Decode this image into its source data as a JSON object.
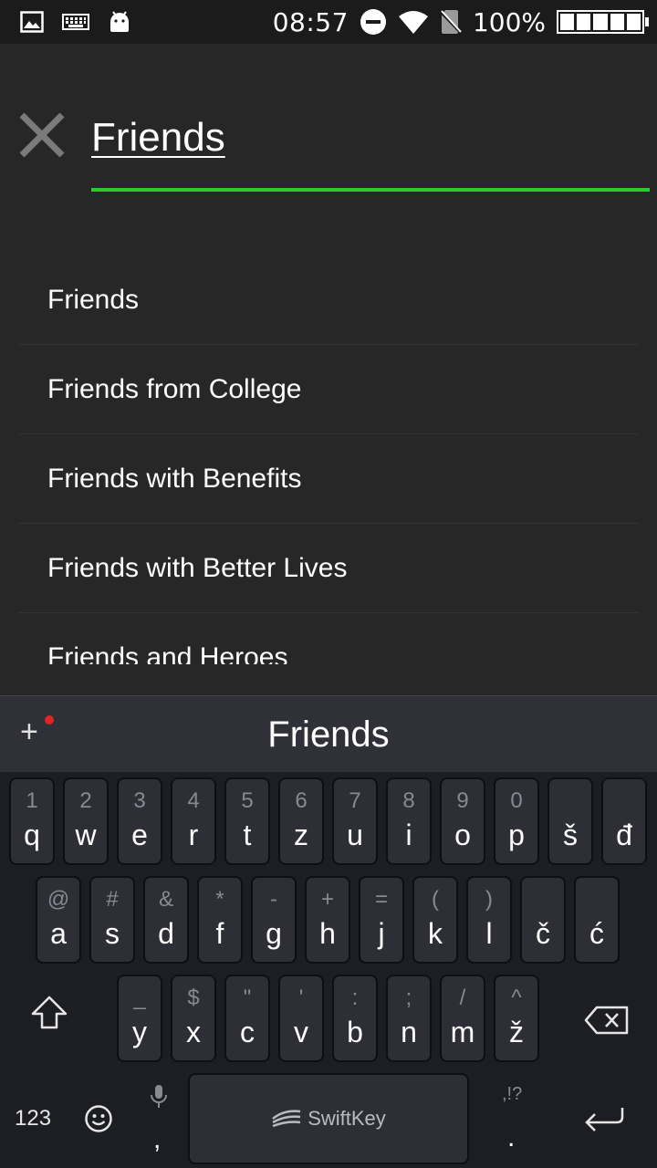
{
  "status_bar": {
    "time": "08:57",
    "battery_percent": "100%",
    "icons": [
      "image-icon",
      "keyboard-icon",
      "android-icon",
      "do-not-disturb-icon",
      "wifi-icon",
      "no-sim-icon",
      "battery-icon"
    ]
  },
  "search": {
    "query": "Friends",
    "close_icon": "close-icon",
    "accent_color": "#2ecc2e"
  },
  "suggestions": [
    "Friends",
    "Friends from College",
    "Friends with Benefits",
    "Friends with Better Lives",
    "Friends and Heroes"
  ],
  "keyboard": {
    "prediction": "Friends",
    "toolbar_icon": "plus-icon",
    "rows": [
      [
        {
          "sec": "1",
          "pri": "q"
        },
        {
          "sec": "2",
          "pri": "w"
        },
        {
          "sec": "3",
          "pri": "e"
        },
        {
          "sec": "4",
          "pri": "r"
        },
        {
          "sec": "5",
          "pri": "t"
        },
        {
          "sec": "6",
          "pri": "z"
        },
        {
          "sec": "7",
          "pri": "u"
        },
        {
          "sec": "8",
          "pri": "i"
        },
        {
          "sec": "9",
          "pri": "o"
        },
        {
          "sec": "0",
          "pri": "p"
        },
        {
          "sec": "",
          "pri": "š"
        },
        {
          "sec": "",
          "pri": "đ"
        }
      ],
      [
        {
          "sec": "@",
          "pri": "a"
        },
        {
          "sec": "#",
          "pri": "s"
        },
        {
          "sec": "&",
          "pri": "d"
        },
        {
          "sec": "*",
          "pri": "f"
        },
        {
          "sec": "-",
          "pri": "g"
        },
        {
          "sec": "+",
          "pri": "h"
        },
        {
          "sec": "=",
          "pri": "j"
        },
        {
          "sec": "(",
          "pri": "k"
        },
        {
          "sec": ")",
          "pri": "l"
        },
        {
          "sec": "",
          "pri": "č"
        },
        {
          "sec": "",
          "pri": "ć"
        }
      ],
      [
        {
          "sec": "_",
          "pri": "y"
        },
        {
          "sec": "$",
          "pri": "x"
        },
        {
          "sec": "\"",
          "pri": "c"
        },
        {
          "sec": "'",
          "pri": "v"
        },
        {
          "sec": ":",
          "pri": "b"
        },
        {
          "sec": ";",
          "pri": "n"
        },
        {
          "sec": "/",
          "pri": "m"
        },
        {
          "sec": "^",
          "pri": "ž"
        }
      ]
    ],
    "numbers_label": "123",
    "comma_label": ",",
    "period_label": ".",
    "punct_hint": ",!?",
    "space_brand": "SwiftKey"
  }
}
